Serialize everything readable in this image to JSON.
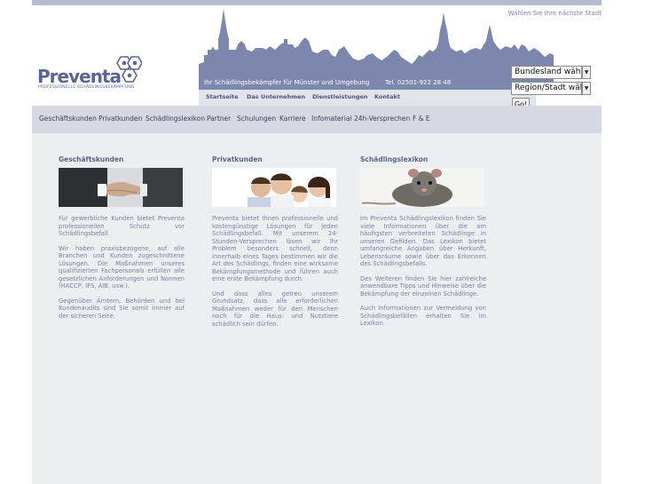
{
  "header": {
    "region_hint": "Wählen Sie Ihre nächste Stadt",
    "logo_text": "Preventa",
    "logo_subtitle": "PROFESSIONELLE SCHÄDLINGSBEKÄMPFUNG",
    "tagline": "Ihr Schädlingsbekämpfer für Münster und Umgebung",
    "phone": "Tel. 02501-922 28 48"
  },
  "main_nav": [
    "Startseite",
    "Das Unternehmen",
    "Dienstleistungen",
    "Kontakt"
  ],
  "selects": {
    "bundesland": "Bundesland wählen",
    "region": "Region/Stadt wählen",
    "go_label": "Go!"
  },
  "sub_nav": [
    "Geschäftskunden",
    "Privatkunden",
    "Schädlingslexikon",
    "Partner",
    "Schulungen",
    "Karriere",
    "Infomaterial",
    "24h-Versprechen",
    "F & E"
  ],
  "columns": [
    {
      "title": "Geschäftskunden",
      "paragraphs": [
        "Für gewerbliche Kunden bietet Preventa professionellen Schutz vor Schädlingsbefall.",
        "Wir haben praxisbezogene, auf alle Branchen und Kunden zugeschnittene Lösungen. Die Maßnahmen unseres qualifizierten Fachpersonals erfüllen alle gesetzlichen Anforderungen und Normen (HACCP, IFS, AIB, usw.).",
        "Gegenüber Ämtern, Behörden und bei Kundenaudits sind Sie somit immer auf der sicheren Seite."
      ]
    },
    {
      "title": "Privatkunden",
      "paragraphs": [
        "Preventa bietet Ihnen professionelle und kostengünstige Lösungen für jeden Schädlingsbefall. Mit unserem 24-Stunden-Versprechen lösen wir Ihr Problem besonders schnell, denn innerhalb eines Tages bestimmen wir die Art des Schädlings, finden eine wirksame Bekämpfungsmethode und führen auch eine erste Bekämpfung durch.",
        "Und dass alles getreu unserem Grundsatz, dass alle erforderlichen Maßnahmen weder für den Menschen noch für die Haus- und Nutztiere schädlich sein dürfen."
      ]
    },
    {
      "title": "Schädlingslexikon",
      "paragraphs": [
        "Im Preventa Schädlingslexikon finden Sie viele Informationen über die am häufigsten verbreiteten Schädlinge in unseren Gefilden. Das Lexikon bietet umfangreiche Angaben über Herkunft, Lebensräume sowie über das Erkennen des Schädlingsbefalls.",
        "Des Weiteren finden Sie hier zahlreiche anwendbare Tipps und Hinweise über die Bekämpfung der einzelnen Schädlinge.",
        "Auch Informationen zur Vermeidung von Schädlingsbefällen erhalten Sie im Lexikon."
      ]
    }
  ],
  "colors": {
    "brand": "#5a6597",
    "skyline": "#7d87ad",
    "nav_bar": "#d6d8e2",
    "content_bg": "#edeef0",
    "body_text": "#7a80a6"
  }
}
